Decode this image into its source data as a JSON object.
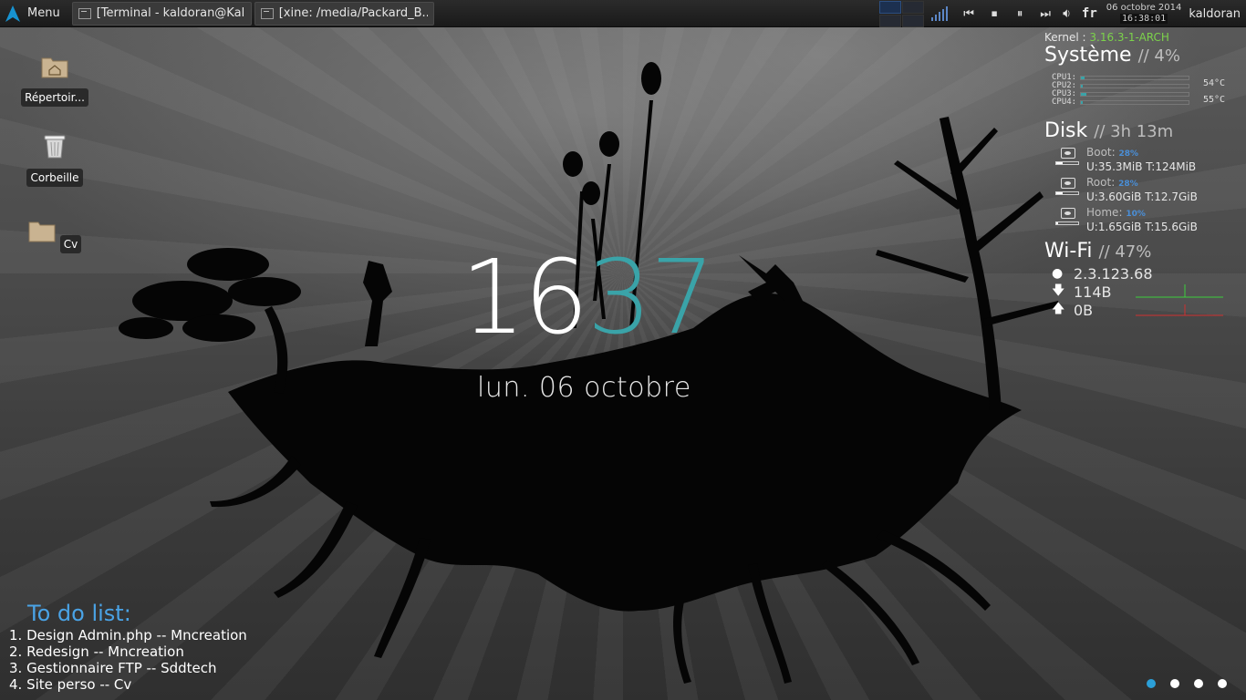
{
  "panel": {
    "menu_label": "Menu",
    "tasks": [
      {
        "label": "[Terminal - kaldoran@Kal..."
      },
      {
        "label": "[xine: /media/Packard_B..."
      }
    ],
    "lang": "fr",
    "date": "06 octobre 2014",
    "time": "16:38:01",
    "user": "kaldoran",
    "accent_color": "#2d4f80"
  },
  "desktop": {
    "icons": [
      {
        "label": "Répertoir...",
        "icon": "home-folder-icon"
      },
      {
        "label": "Corbeille",
        "icon": "trash-icon"
      },
      {
        "label": "Cv",
        "icon": "folder-icon"
      }
    ]
  },
  "clock": {
    "hours": "16",
    "minutes": "37",
    "date": "lun. 06 octobre",
    "minutes_color": "#3aa3a8"
  },
  "conky": {
    "kernel_label": "Kernel :",
    "kernel_value": "3.16.3-1-ARCH",
    "system_title": "Système",
    "system_sub": "// 4%",
    "cpus": [
      {
        "label": "CPU1:",
        "load": 0.03
      },
      {
        "label": "CPU2:",
        "load": 0.02
      },
      {
        "label": "CPU3:",
        "load": 0.05
      },
      {
        "label": "CPU4:",
        "load": 0.02
      }
    ],
    "temps": [
      "54°C",
      "55°C"
    ],
    "disk_title": "Disk",
    "disk_sub": "// 3h 13m",
    "disks": [
      {
        "name": "Boot:",
        "pct": "28%",
        "usage": "U:35.3MiB T:124MiB",
        "fill": 0.28
      },
      {
        "name": "Root:",
        "pct": "28%",
        "usage": "U:3.60GiB T:12.7GiB",
        "fill": 0.28
      },
      {
        "name": "Home:",
        "pct": "10%",
        "usage": "U:1.65GiB T:15.6GiB",
        "fill": 0.1
      }
    ],
    "wifi_title": "Wi-Fi",
    "wifi_sub": "// 47%",
    "ip": "2.3.123.68",
    "down": "114B",
    "up": "0B",
    "down_color": "#3ccf3c",
    "up_color": "#d03030"
  },
  "todo": {
    "title": "To do list:",
    "items": [
      "1. Design Admin.php -- Mncreation",
      "2. Redesign -- Mncreation",
      "3. Gestionnaire FTP -- Sddtech",
      "4. Site perso -- Cv"
    ]
  },
  "pages": {
    "count": 4,
    "active": 1,
    "active_color": "#2b9fd8"
  }
}
